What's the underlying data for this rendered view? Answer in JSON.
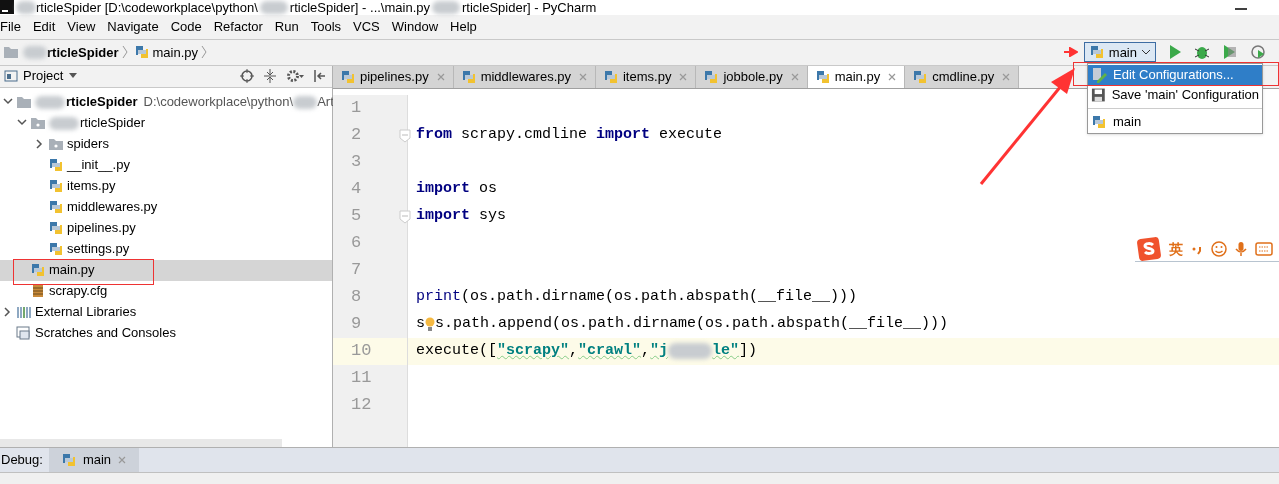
{
  "window": {
    "title_segments": [
      "rticleSpider [D:\\codeworkplace\\python\\",
      "rticleSpider] - ...\\main.py",
      "rticleSpider] - PyCharm"
    ]
  },
  "menu": [
    "File",
    "Edit",
    "View",
    "Navigate",
    "Code",
    "Refactor",
    "Run",
    "Tools",
    "VCS",
    "Window",
    "Help"
  ],
  "breadcrumb": [
    "rticleSpider",
    "main.py"
  ],
  "run_config": {
    "label": "main",
    "menu": [
      {
        "label": "Edit Configurations...",
        "kind": "edit",
        "selected": true
      },
      {
        "label": "Save 'main' Configuration",
        "kind": "save",
        "selected": false
      },
      {
        "label": "main",
        "kind": "python",
        "selected": false
      }
    ]
  },
  "project_panel": {
    "title": "Project",
    "tree": [
      {
        "label": "rticleSpider",
        "path": "D:\\codeworkplace\\python\\",
        "path_tail": "Art",
        "kind": "folder",
        "expanded": true,
        "selected": false,
        "children": [
          {
            "label": "rticleSpider",
            "kind": "package",
            "expanded": true,
            "selected": false,
            "children": [
              {
                "label": "spiders",
                "kind": "package",
                "expanded": false,
                "selected": false
              },
              {
                "label": "__init__.py",
                "kind": "python",
                "selected": false
              },
              {
                "label": "items.py",
                "kind": "python",
                "selected": false
              },
              {
                "label": "middlewares.py",
                "kind": "python",
                "selected": false
              },
              {
                "label": "pipelines.py",
                "kind": "python",
                "selected": false
              },
              {
                "label": "settings.py",
                "kind": "python",
                "selected": false
              }
            ]
          },
          {
            "label": "main.py",
            "kind": "python",
            "selected": true
          },
          {
            "label": "scrapy.cfg",
            "kind": "config",
            "selected": false
          }
        ]
      },
      {
        "label": "External Libraries",
        "kind": "libraries",
        "expanded": false,
        "selected": false
      },
      {
        "label": "Scratches and Consoles",
        "kind": "scratches",
        "selected": false
      }
    ]
  },
  "editor_tabs": [
    {
      "label": "pipelines.py",
      "selected": false
    },
    {
      "label": "middlewares.py",
      "selected": false
    },
    {
      "label": "items.py",
      "selected": false
    },
    {
      "label": "jobbole.py",
      "selected": false
    },
    {
      "label": "main.py",
      "selected": true
    },
    {
      "label": "cmdline.py",
      "selected": false
    }
  ],
  "code_lines": [
    {
      "number": "1",
      "current": false
    },
    {
      "number": "2",
      "current": false,
      "tokens": [
        {
          "text": "from",
          "kind": "keyword"
        },
        {
          "text": " scrapy.cmdline ",
          "kind": "plain"
        },
        {
          "text": "import",
          "kind": "keyword"
        },
        {
          "text": " execute",
          "kind": "plain"
        }
      ]
    },
    {
      "number": "3",
      "current": false
    },
    {
      "number": "4",
      "current": false,
      "tokens": [
        {
          "text": "import",
          "kind": "keyword"
        },
        {
          "text": " os",
          "kind": "plain"
        }
      ]
    },
    {
      "number": "5",
      "current": false,
      "tokens": [
        {
          "text": "import",
          "kind": "keyword"
        },
        {
          "text": " sys",
          "kind": "plain"
        }
      ]
    },
    {
      "number": "6",
      "current": false
    },
    {
      "number": "7",
      "current": false
    },
    {
      "number": "8",
      "current": false,
      "tokens": [
        {
          "text": "print",
          "kind": "builtin"
        },
        {
          "text": "(os.path.dirname(os.path.abspath(__file__)))",
          "kind": "plain"
        }
      ]
    },
    {
      "number": "9",
      "current": false,
      "tokens": [
        {
          "text": "s",
          "kind": "plain"
        },
        {
          "kind": "bulb"
        },
        {
          "text": "s.path.append(os.path.dirname(os.path.abspath(__file__)))",
          "kind": "plain"
        }
      ]
    },
    {
      "number": "10",
      "current": true,
      "tokens": [
        {
          "text": "execute([",
          "kind": "plain"
        },
        {
          "text": "\"scrapy\"",
          "kind": "string"
        },
        {
          "text": ",",
          "kind": "plain"
        },
        {
          "text": "\"crawl\"",
          "kind": "string"
        },
        {
          "text": ",",
          "kind": "plain"
        },
        {
          "text": "\"j",
          "kind": "string"
        },
        {
          "kind": "blur"
        },
        {
          "text": "le\"",
          "kind": "string"
        },
        {
          "text": "])",
          "kind": "plain"
        }
      ]
    },
    {
      "number": "11",
      "current": false
    },
    {
      "number": "12",
      "current": false
    }
  ],
  "ime_toolbar": {
    "label": "英"
  },
  "debug_bar": {
    "label": "Debug:",
    "tabs": [
      {
        "label": "main",
        "selected": true
      }
    ]
  }
}
